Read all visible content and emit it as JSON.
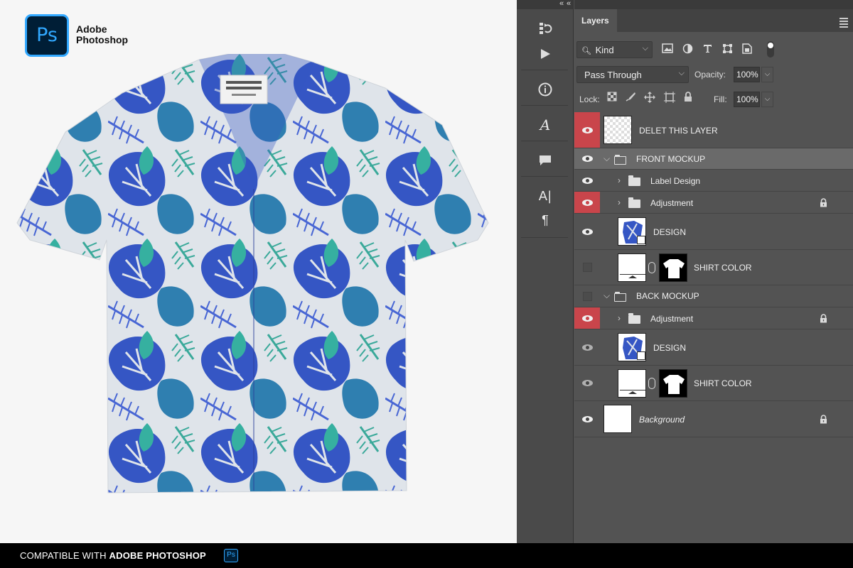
{
  "brand": {
    "logo_text": "Ps",
    "line1": "Adobe",
    "line2": "Photoshop"
  },
  "footer": {
    "prefix": "COMPATIBLE WITH",
    "bold": "ADOBE PHOTOSHOP",
    "badge": "Ps"
  },
  "toolstrip": {
    "collapse_icon": "double-chevron-left-icon",
    "tools": [
      "history-icon",
      "play-icon",
      "info-icon",
      "glyph-icon",
      "comment-icon",
      "character-icon",
      "paragraph-icon"
    ]
  },
  "panel": {
    "tab": "Layers",
    "filter": {
      "kind_label": "Kind",
      "icons": [
        "image-filter-icon",
        "adjustment-filter-icon",
        "type-filter-icon",
        "shape-filter-icon",
        "smart-object-filter-icon"
      ]
    },
    "blend_mode": "Pass Through",
    "opacity_label": "Opacity:",
    "opacity_value": "100%",
    "lock_label": "Lock:",
    "fill_label": "Fill:",
    "fill_value": "100%",
    "lock_icons": [
      "lock-transparent-icon",
      "lock-image-icon",
      "lock-position-icon",
      "lock-artboard-icon",
      "lock-all-icon"
    ]
  },
  "layers": [
    {
      "name": "DELET THIS LAYER",
      "visible": true,
      "highlight": true
    },
    {
      "name": "FRONT MOCKUP",
      "visible": true,
      "type": "group",
      "selected": true
    },
    {
      "name": "Label Design",
      "visible": true,
      "type": "group"
    },
    {
      "name": "Adjustment",
      "visible": true,
      "highlight": true,
      "type": "group",
      "locked": true
    },
    {
      "name": "DESIGN",
      "visible": true,
      "type": "smart"
    },
    {
      "name": "SHIRT COLOR",
      "visible": false,
      "type": "fill-mask"
    },
    {
      "name": "BACK MOCKUP",
      "visible": false,
      "type": "group"
    },
    {
      "name": "Adjustment",
      "visible": true,
      "highlight": true,
      "type": "group",
      "locked": true
    },
    {
      "name": "DESIGN",
      "visible": true,
      "type": "smart"
    },
    {
      "name": "SHIRT COLOR",
      "visible": true,
      "type": "fill-mask"
    },
    {
      "name": "Background",
      "visible": true,
      "type": "background",
      "locked": true
    }
  ],
  "colors": {
    "ps_blue": "#31a8ff",
    "ps_navy": "#001e36",
    "visibility_highlight": "#c9454b",
    "shirt_blue": "#3556c4",
    "leaf_teal": "#3aa99a"
  }
}
